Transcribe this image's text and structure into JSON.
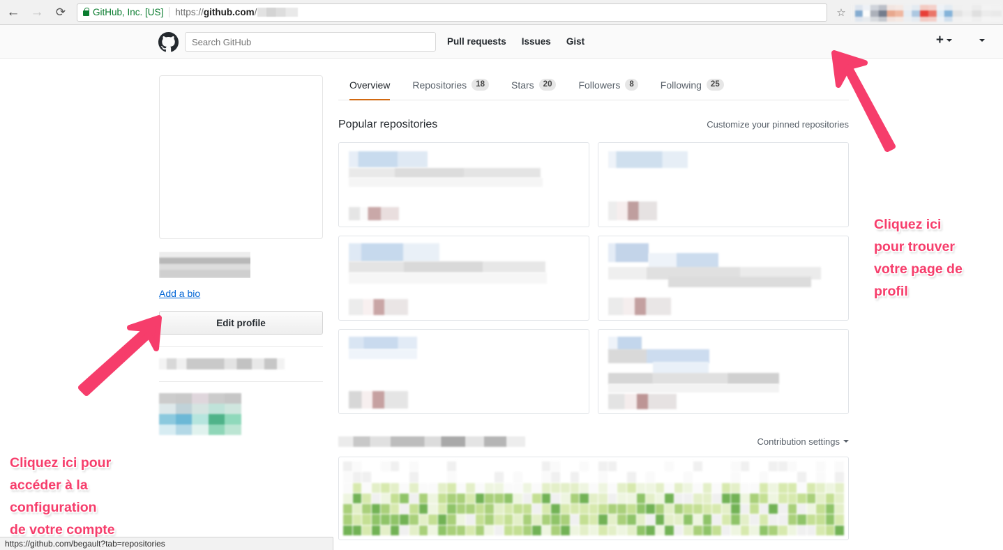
{
  "browser": {
    "back_icon": "arrow-left-icon",
    "forward_icon": "arrow-right-icon",
    "reload_icon": "reload-icon",
    "security_label": "GitHub, Inc. [US]",
    "url_scheme": "https://",
    "url_host": "github.com",
    "url_separator": "/",
    "bookmark_icon": "star-icon",
    "status_url": "https://github.com/begault?tab=repositories"
  },
  "gh_header": {
    "logo": "github-mark-icon",
    "search_placeholder": "Search GitHub",
    "search_value": "",
    "nav": [
      "Pull requests",
      "Issues",
      "Gist"
    ],
    "create_menu_label": "+",
    "avatar_alt": "owl-avatar"
  },
  "sidebar": {
    "avatar_alt": "owl-avatar-large",
    "name_redacted": true,
    "bio_link": "Add a bio",
    "edit_profile": "Edit profile",
    "meta_redacted": true,
    "orgs_redacted": true
  },
  "profile_tabs": [
    {
      "label": "Overview",
      "count": null,
      "active": true
    },
    {
      "label": "Repositories",
      "count": "18",
      "active": false
    },
    {
      "label": "Stars",
      "count": "20",
      "active": false
    },
    {
      "label": "Followers",
      "count": "8",
      "active": false
    },
    {
      "label": "Following",
      "count": "25",
      "active": false
    }
  ],
  "popular": {
    "title": "Popular repositories",
    "customize_link": "Customize your pinned repositories",
    "cards": [
      {
        "redacted": true
      },
      {
        "redacted": true
      },
      {
        "redacted": true
      },
      {
        "redacted": true
      },
      {
        "redacted": true
      },
      {
        "redacted": true
      }
    ]
  },
  "contributions": {
    "title_redacted": true,
    "settings_label": "Contribution settings",
    "settings_caret": "chevron-down-icon"
  },
  "annotations": [
    {
      "id": "account-settings",
      "text": "Cliquez ici pour\naccéder à la\nconfiguration\nde votre compte",
      "color": "#f63d6b"
    },
    {
      "id": "profile-page",
      "text": "Cliquez ici\npour trouver\nvotre page de\nprofil",
      "color": "#f63d6b"
    }
  ],
  "colors": {
    "annotation": "#f63d6b",
    "active_tab_underline": "#d26911",
    "link": "#0366d6",
    "secure_green": "#0a7c2f"
  }
}
